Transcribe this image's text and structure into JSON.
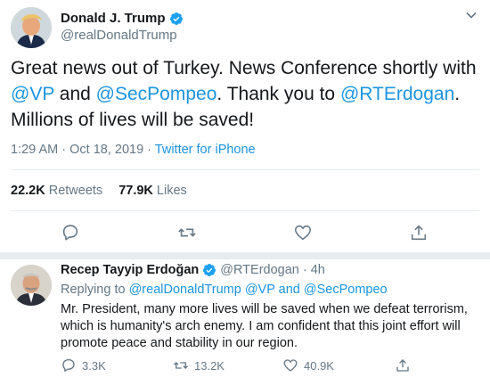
{
  "main_tweet": {
    "author_name": "Donald J. Trump",
    "author_handle": "@realDonaldTrump",
    "text_parts": [
      {
        "text": "Great news out of Turkey. News Conference shortly with ",
        "link": false
      },
      {
        "text": "@VP",
        "link": true
      },
      {
        "text": " and ",
        "link": false
      },
      {
        "text": "@SecPompeo",
        "link": true
      },
      {
        "text": ". Thank you to ",
        "link": false
      },
      {
        "text": "@RTErdogan",
        "link": true
      },
      {
        "text": ". Millions of lives will be saved!",
        "link": false
      }
    ],
    "time": "1:29 AM",
    "dot": "·",
    "date": "Oct 18, 2019",
    "source": "Twitter for iPhone",
    "retweets_count": "22.2K",
    "retweets_label": "Retweets",
    "likes_count": "77.9K",
    "likes_label": "Likes",
    "icons": {
      "reply": "reply-icon",
      "retweet": "retweet-icon",
      "like": "heart-icon",
      "share": "share-icon",
      "verified": "verified-badge-icon",
      "menu": "chevron-down-icon"
    }
  },
  "reply_tweet": {
    "author_name": "Recep Tayyip Erdoğan",
    "author_handle": "@RTErdogan",
    "dot": "·",
    "age": "4h",
    "replying_label": "Replying to",
    "replying_to": [
      {
        "text": "@realDonaldTrump",
        "link": true
      },
      {
        "text": " ",
        "link": false
      },
      {
        "text": "@VP",
        "link": true
      },
      {
        "text": " and ",
        "link": true
      },
      {
        "text": "@SecPompeo",
        "link": true
      }
    ],
    "text": "Mr. President, many more lives will be saved when we defeat terrorism, which is humanity's arch enemy. I am confident that this joint effort will promote peace and stability in our region.",
    "reply_count": "3.3K",
    "retweet_count": "13.2K",
    "like_count": "40.9K"
  },
  "colors": {
    "link": "#1b95e0",
    "verified": "#1da1f2",
    "muted": "#657786",
    "divider": "#e6ecf0"
  }
}
